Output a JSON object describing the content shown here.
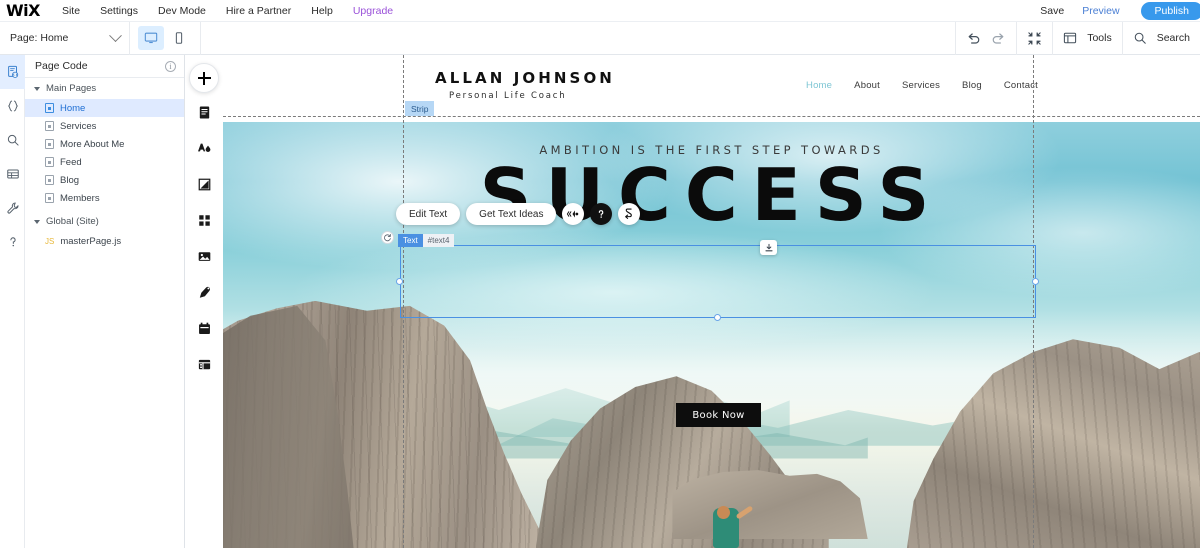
{
  "topbar": {
    "logo": "WiX",
    "menu": [
      {
        "label": "Site"
      },
      {
        "label": "Settings"
      },
      {
        "label": "Dev Mode"
      },
      {
        "label": "Hire a Partner"
      },
      {
        "label": "Help"
      },
      {
        "label": "Upgrade"
      }
    ],
    "save_label": "Save",
    "preview_label": "Preview",
    "publish_label": "Publish",
    "accent_blue": "#3899ec",
    "upgrade_purple": "#9a51d9"
  },
  "secondbar": {
    "page_selector_label": "Page: Home",
    "tools_label": "Tools",
    "search_label": "Search"
  },
  "code_panel": {
    "title": "Page Code",
    "groups": [
      {
        "label": "Main Pages",
        "items": [
          {
            "label": "Home",
            "selected": true
          },
          {
            "label": "Services",
            "selected": false
          },
          {
            "label": "More About Me",
            "selected": false
          },
          {
            "label": "Feed",
            "selected": false
          },
          {
            "label": "Blog",
            "selected": false
          },
          {
            "label": "Members",
            "selected": false
          }
        ]
      },
      {
        "label": "Global (Site)",
        "items": [
          {
            "label": "masterPage.js",
            "selected": false
          }
        ]
      }
    ]
  },
  "rail": {
    "icons": [
      "page-code-icon",
      "code-brackets-icon",
      "search-icon",
      "database-icon",
      "wrench-tools-icon",
      "help-question-icon"
    ]
  },
  "addbar": {
    "icons": [
      "add-plus-icon",
      "pages-icon",
      "design-theme-icon",
      "background-icon",
      "apps-grid-icon",
      "media-image-icon",
      "blog-pen-icon",
      "bookings-calendar-icon",
      "database-table-icon"
    ]
  },
  "site": {
    "brand": "ALLAN JOHNSON",
    "brand_sub": "Personal Life Coach",
    "nav": [
      {
        "label": "Home",
        "active": true
      },
      {
        "label": "About",
        "active": false
      },
      {
        "label": "Services",
        "active": false
      },
      {
        "label": "Blog",
        "active": false
      },
      {
        "label": "Contact",
        "active": false
      }
    ],
    "tagline": "AMBITION IS THE FIRST STEP TOWARDS",
    "headline": "SUCCESS",
    "cta_label": "Book Now",
    "nav_active_color": "#7ec6d4"
  },
  "overlays": {
    "strip_tag": "Strip",
    "element_tag_name": "Text",
    "element_tag_id": "#text4",
    "selection_color": "#4a90e2",
    "toolbar": {
      "edit_text_label": "Edit Text",
      "get_text_ideas_label": "Get Text Ideas",
      "icons": [
        "animation-effects-icon",
        "help-question-icon",
        "stretch-link-icon"
      ]
    }
  }
}
